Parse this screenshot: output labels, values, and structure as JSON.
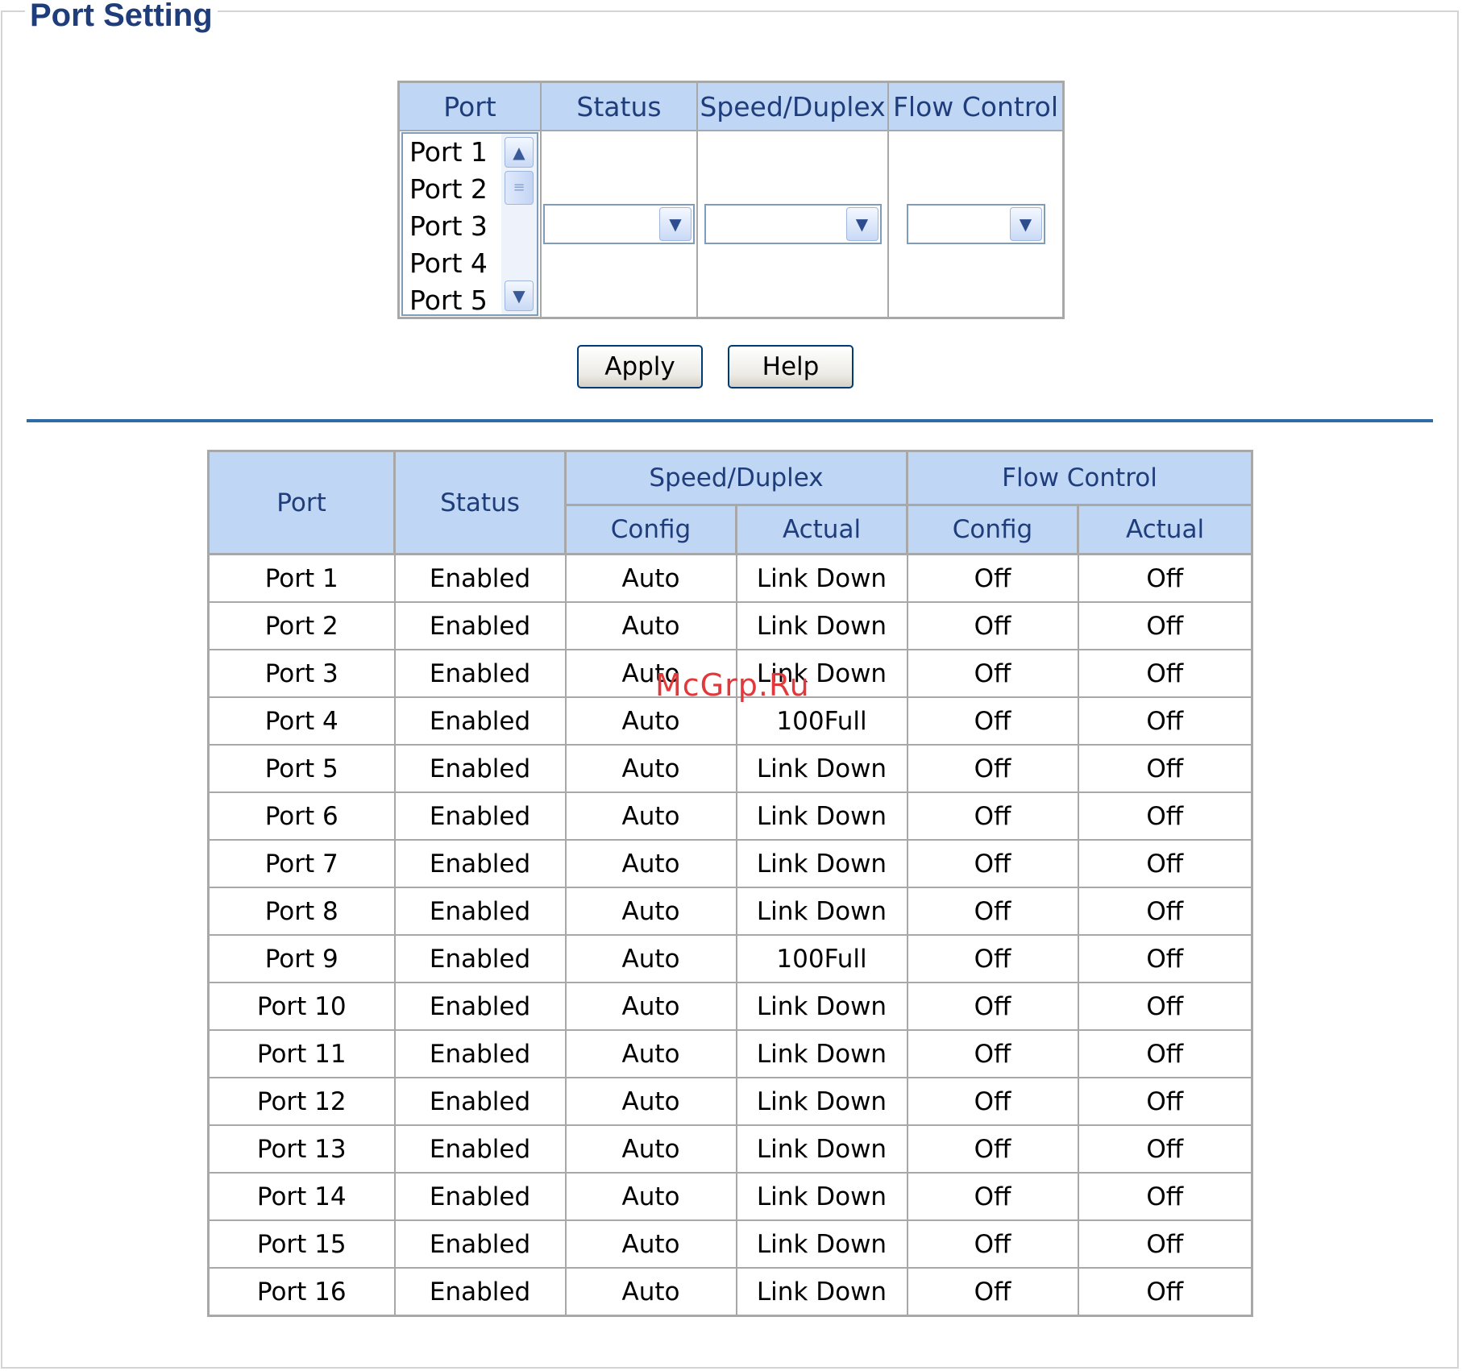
{
  "page_title": "Port Setting",
  "config": {
    "headers": {
      "port": "Port",
      "status": "Status",
      "speed": "Speed/Duplex",
      "flow": "Flow Control"
    },
    "port_list": [
      "Port 1",
      "Port 2",
      "Port 3",
      "Port 4",
      "Port 5"
    ],
    "status_value": "",
    "speed_value": "",
    "flow_value": ""
  },
  "buttons": {
    "apply": "Apply",
    "help": "Help"
  },
  "table": {
    "headers": {
      "port": "Port",
      "status": "Status",
      "speed": "Speed/Duplex",
      "flow": "Flow Control",
      "speed_config": "Config",
      "speed_actual": "Actual",
      "flow_config": "Config",
      "flow_actual": "Actual"
    },
    "rows": [
      [
        "Port 1",
        "Enabled",
        "Auto",
        "Link Down",
        "Off",
        "Off"
      ],
      [
        "Port 2",
        "Enabled",
        "Auto",
        "Link Down",
        "Off",
        "Off"
      ],
      [
        "Port 3",
        "Enabled",
        "Auto",
        "Link Down",
        "Off",
        "Off"
      ],
      [
        "Port 4",
        "Enabled",
        "Auto",
        "100Full",
        "Off",
        "Off"
      ],
      [
        "Port 5",
        "Enabled",
        "Auto",
        "Link Down",
        "Off",
        "Off"
      ],
      [
        "Port 6",
        "Enabled",
        "Auto",
        "Link Down",
        "Off",
        "Off"
      ],
      [
        "Port 7",
        "Enabled",
        "Auto",
        "Link Down",
        "Off",
        "Off"
      ],
      [
        "Port 8",
        "Enabled",
        "Auto",
        "Link Down",
        "Off",
        "Off"
      ],
      [
        "Port 9",
        "Enabled",
        "Auto",
        "100Full",
        "Off",
        "Off"
      ],
      [
        "Port 10",
        "Enabled",
        "Auto",
        "Link Down",
        "Off",
        "Off"
      ],
      [
        "Port 11",
        "Enabled",
        "Auto",
        "Link Down",
        "Off",
        "Off"
      ],
      [
        "Port 12",
        "Enabled",
        "Auto",
        "Link Down",
        "Off",
        "Off"
      ],
      [
        "Port 13",
        "Enabled",
        "Auto",
        "Link Down",
        "Off",
        "Off"
      ],
      [
        "Port 14",
        "Enabled",
        "Auto",
        "Link Down",
        "Off",
        "Off"
      ],
      [
        "Port 15",
        "Enabled",
        "Auto",
        "Link Down",
        "Off",
        "Off"
      ],
      [
        "Port 16",
        "Enabled",
        "Auto",
        "Link Down",
        "Off",
        "Off"
      ]
    ]
  },
  "watermark": "McGrp.Ru",
  "icons": {
    "scroll_up": "chevron-up-icon",
    "scroll_down": "chevron-down-icon",
    "dropdown": "chevron-down-icon"
  },
  "colors": {
    "header_bg": "#bfd6f5",
    "header_text": "#1f3d7a",
    "divider": "#2e6ca4",
    "title": "#1f3d7a",
    "watermark": "#e0383b"
  }
}
